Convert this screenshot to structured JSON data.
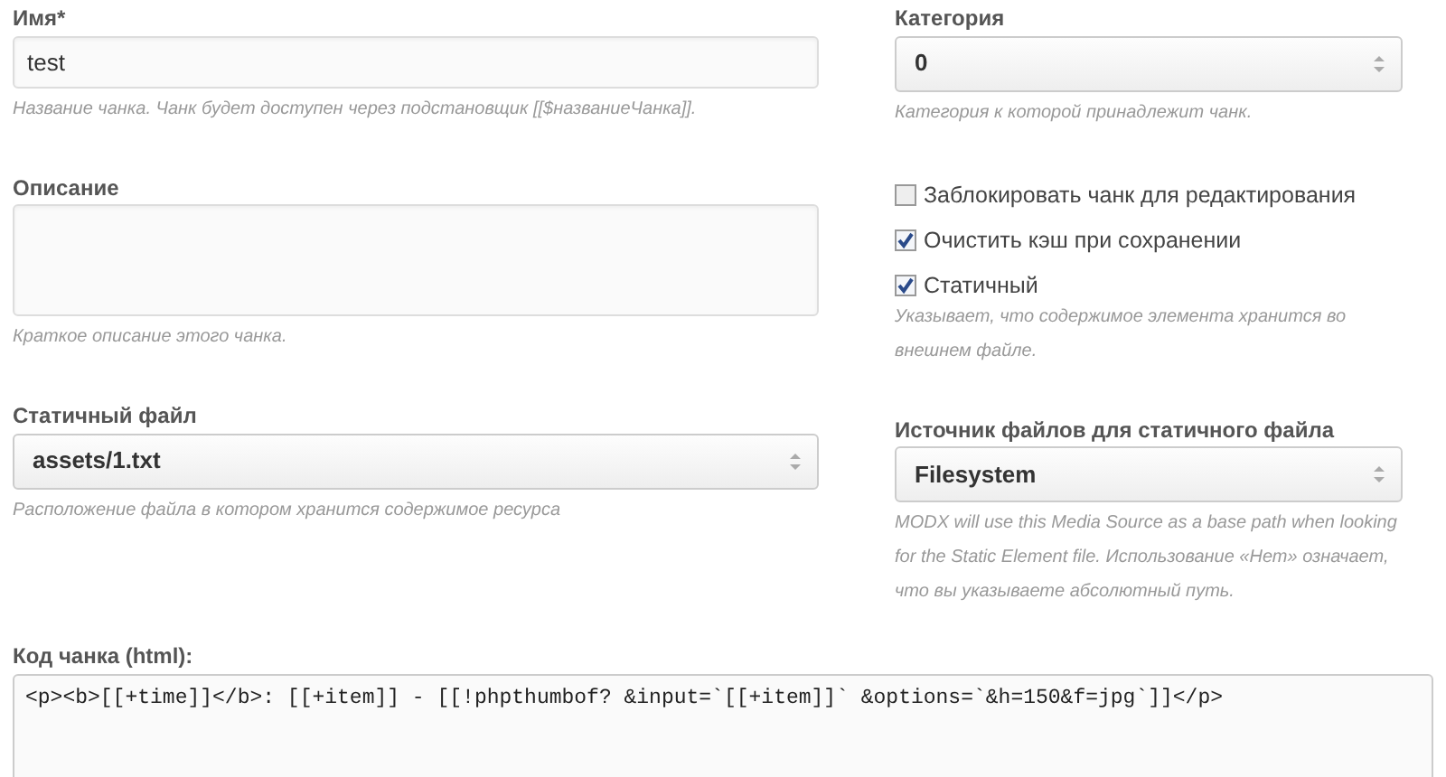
{
  "left": [
    {
      "kind": "text",
      "label": "Имя*",
      "value": "test",
      "help": "Название чанка. Чанк будет доступен через подстановщик [[$названиеЧанка]]."
    },
    {
      "kind": "textarea",
      "label": "Описание",
      "help": "Краткое описание этого чанка."
    },
    {
      "kind": "select",
      "label": "Статичный файл",
      "value": "assets/1.txt",
      "help": "Расположение файла в котором хранится содержимое ресурса"
    }
  ],
  "right": [
    {
      "kind": "select",
      "label": "Категория",
      "value": "0",
      "help": "Категория к которой принадлежит чанк."
    },
    {
      "kind": "checkbox",
      "label": "Заблокировать чанк для редактирования",
      "checked": false
    },
    {
      "kind": "checkbox",
      "label": "Очистить кэш при сохранении",
      "checked": true
    },
    {
      "kind": "checkbox",
      "label": "Статичный",
      "checked": true,
      "help": "Указывает, что содержимое элемента хранится во внешнем файле."
    },
    {
      "kind": "select",
      "label": "Источник файлов для статичного файла",
      "value": "Filesystem",
      "help": "MODX will use this Media Source as a base path when looking for the Static Element file. Использование «Нет» означает, что вы указываете абсолютный путь."
    }
  ],
  "code": {
    "label": "Код чанка (html):",
    "value": "<p><b>[[+time]]</b>: [[+item]] - [[!phpthumbof? &input=`[[+item]]` &options=`&h=150&f=jpg`]]</p>"
  }
}
